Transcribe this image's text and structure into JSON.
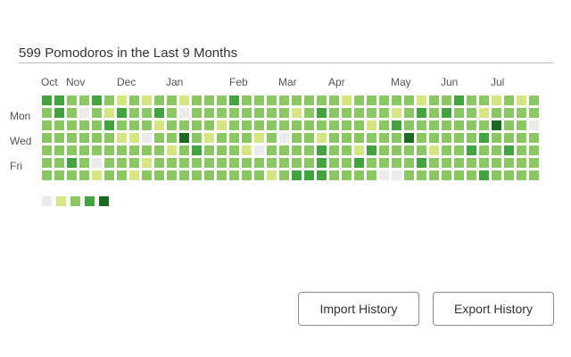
{
  "history": {
    "title": "599 Pomodoros in the Last 9 Months",
    "months": [
      "Oct",
      "Nov",
      "Dec",
      "Jan",
      "Feb",
      "Mar",
      "Apr",
      "May",
      "Jun",
      "Jul"
    ],
    "days": [
      "Mon",
      "Wed",
      "Fri"
    ],
    "colors": [
      "#ebebeb",
      "#d6e685",
      "#8cc665",
      "#44a340",
      "#1e6823"
    ],
    "weeks": [
      [
        3,
        2,
        2,
        2,
        2,
        2,
        2
      ],
      [
        3,
        3,
        2,
        2,
        2,
        2,
        2
      ],
      [
        2,
        2,
        2,
        2,
        2,
        3,
        2
      ],
      [
        2,
        0,
        2,
        2,
        2,
        2,
        2
      ],
      [
        3,
        2,
        2,
        2,
        2,
        0,
        1
      ],
      [
        2,
        1,
        3,
        2,
        2,
        2,
        2
      ],
      [
        1,
        3,
        2,
        1,
        2,
        2,
        2
      ],
      [
        2,
        2,
        2,
        1,
        2,
        2,
        1
      ],
      [
        1,
        2,
        2,
        0,
        2,
        1,
        2
      ],
      [
        2,
        3,
        1,
        2,
        2,
        2,
        2
      ],
      [
        2,
        2,
        2,
        2,
        1,
        2,
        2
      ],
      [
        1,
        0,
        2,
        4,
        2,
        2,
        2
      ],
      [
        2,
        2,
        2,
        2,
        3,
        2,
        2
      ],
      [
        2,
        2,
        2,
        1,
        2,
        2,
        2
      ],
      [
        2,
        2,
        1,
        2,
        2,
        2,
        2
      ],
      [
        3,
        2,
        2,
        2,
        2,
        2,
        2
      ],
      [
        2,
        2,
        2,
        2,
        1,
        2,
        2
      ],
      [
        2,
        2,
        2,
        1,
        0,
        2,
        2
      ],
      [
        2,
        2,
        2,
        2,
        2,
        2,
        1
      ],
      [
        2,
        2,
        2,
        0,
        2,
        2,
        2
      ],
      [
        2,
        1,
        2,
        2,
        2,
        2,
        3
      ],
      [
        2,
        2,
        2,
        2,
        2,
        2,
        3
      ],
      [
        2,
        3,
        2,
        1,
        3,
        3,
        3
      ],
      [
        2,
        2,
        2,
        2,
        2,
        2,
        2
      ],
      [
        1,
        2,
        2,
        2,
        2,
        2,
        2
      ],
      [
        2,
        2,
        2,
        2,
        1,
        3,
        2
      ],
      [
        2,
        2,
        1,
        2,
        3,
        2,
        2
      ],
      [
        2,
        2,
        2,
        2,
        2,
        2,
        0
      ],
      [
        2,
        1,
        3,
        2,
        2,
        2,
        0
      ],
      [
        2,
        2,
        2,
        4,
        2,
        2,
        2
      ],
      [
        1,
        3,
        2,
        2,
        2,
        3,
        2
      ],
      [
        2,
        2,
        2,
        2,
        1,
        2,
        2
      ],
      [
        2,
        3,
        2,
        2,
        2,
        2,
        2
      ],
      [
        3,
        2,
        2,
        2,
        2,
        2,
        2
      ],
      [
        2,
        2,
        2,
        2,
        3,
        2,
        2
      ],
      [
        2,
        1,
        2,
        3,
        2,
        2,
        3
      ],
      [
        1,
        2,
        4,
        2,
        2,
        2,
        2
      ],
      [
        2,
        2,
        2,
        2,
        3,
        2,
        2
      ],
      [
        1,
        2,
        2,
        2,
        2,
        2,
        2
      ],
      [
        2,
        2,
        0,
        2,
        2,
        2,
        2
      ]
    ]
  },
  "buttons": {
    "import": "Import History",
    "export": "Export History"
  }
}
